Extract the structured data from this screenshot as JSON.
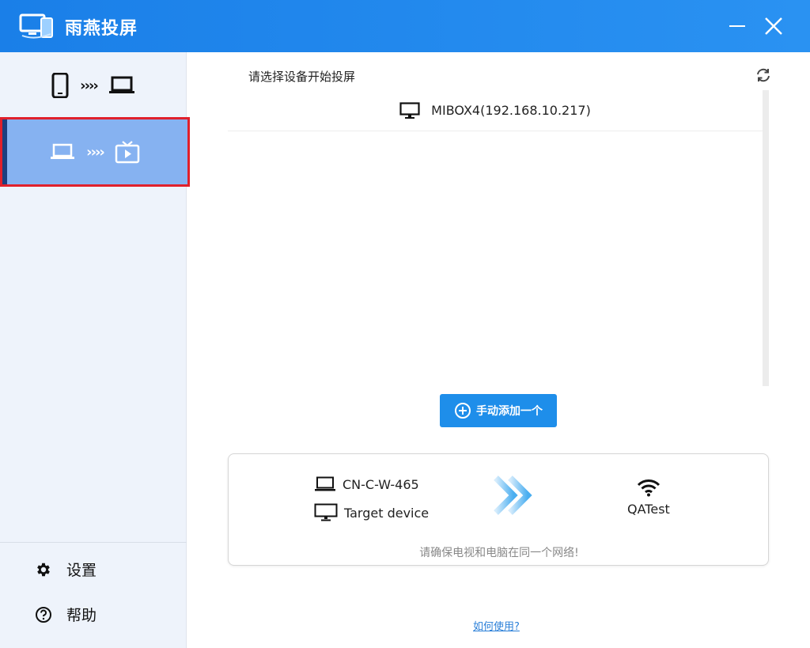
{
  "app": {
    "title": "雨燕投屏"
  },
  "sidebar": {
    "modes": [
      {
        "arrows": "››››"
      },
      {
        "arrows": "››››"
      }
    ],
    "settings_label": "设置",
    "help_label": "帮助"
  },
  "main": {
    "select_title": "请选择设备开始投屏",
    "devices": [
      {
        "name": "MIBOX4(192.168.10.217)"
      }
    ],
    "add_button_label": "手动添加一个",
    "info": {
      "pc_name": "CN-C-W-465",
      "target_label": "Target device",
      "network_name": "QATest",
      "hint": "请确保电视和电脑在同一个网络!"
    },
    "howto_label": "如何使用?"
  },
  "colors": {
    "titlebar": "#1a7fe8",
    "selected_mode": "#86b2f1",
    "highlight_border": "#e0202b",
    "accent_button": "#1e8eea"
  }
}
